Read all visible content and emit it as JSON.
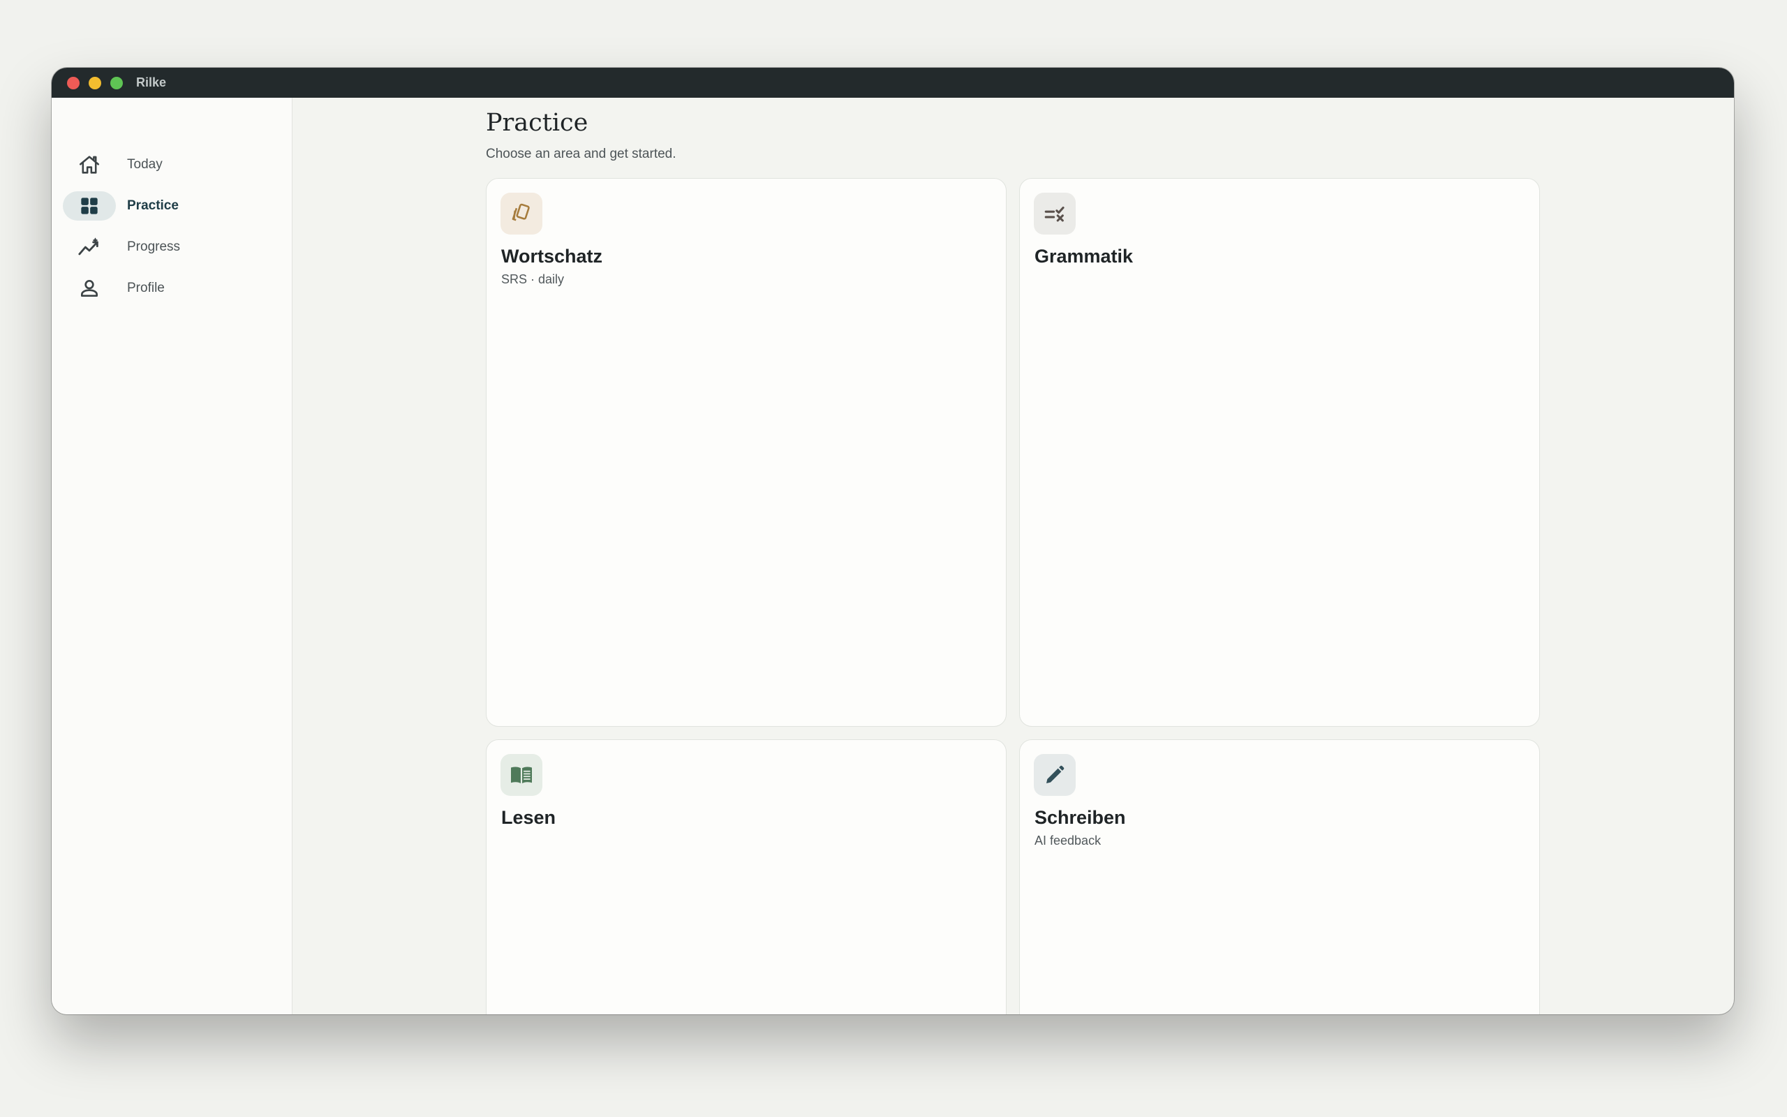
{
  "window": {
    "title": "Rilke"
  },
  "sidebar": {
    "items": [
      {
        "label": "Today",
        "icon": "home-icon",
        "active": false
      },
      {
        "label": "Practice",
        "icon": "grid-icon",
        "active": true
      },
      {
        "label": "Progress",
        "icon": "trend-icon",
        "active": false
      },
      {
        "label": "Profile",
        "icon": "person-icon",
        "active": false
      }
    ]
  },
  "main": {
    "title": "Practice",
    "subtitle": "Choose an area and get started.",
    "cards": [
      {
        "title": "Wortschatz",
        "subtitle": "SRS · daily",
        "icon": "flashcards-icon",
        "icon_bg": "#f3ebe0",
        "icon_color": "#a67c3d"
      },
      {
        "title": "Grammatik",
        "subtitle": "",
        "icon": "checklist-icon",
        "icon_bg": "#ebebe8",
        "icon_color": "#5a514c"
      },
      {
        "title": "Lesen",
        "subtitle": "",
        "icon": "book-icon",
        "icon_bg": "#e6ede6",
        "icon_color": "#4f7a5a"
      },
      {
        "title": "Schreiben",
        "subtitle": "AI feedback",
        "icon": "pencil-icon",
        "icon_bg": "#e6eaea",
        "icon_color": "#33505a"
      }
    ]
  },
  "colors": {
    "accent": "#1f3d47",
    "titlebar": "#232a2c",
    "background": "#f3f4f0"
  }
}
